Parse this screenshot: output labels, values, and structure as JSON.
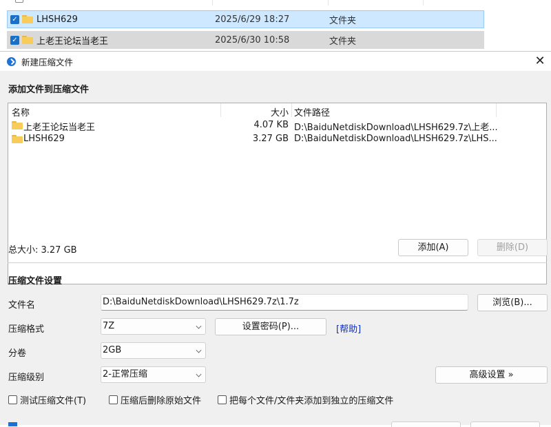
{
  "explorer": {
    "rows": [
      {
        "name": "LHSH629",
        "date": "2025/6/29 18:27",
        "type": "文件夹",
        "checked": true,
        "state": "selected"
      },
      {
        "name": "上老王论坛当老王",
        "date": "2025/6/30 10:58",
        "type": "文件夹",
        "checked": true,
        "state": "selected-inactive"
      }
    ]
  },
  "dialog": {
    "title": "新建压缩文件",
    "add_section_title": "添加文件到压缩文件",
    "list": {
      "col_name": "名称",
      "col_size": "大小",
      "col_path": "文件路径",
      "items": [
        {
          "name": "上老王论坛当老王",
          "size": "4.07 KB",
          "path": "D:\\BaiduNetdiskDownload\\LHSH629.7z\\上老..."
        },
        {
          "name": "LHSH629",
          "size": "3.27 GB",
          "path": "D:\\BaiduNetdiskDownload\\LHSH629.7z\\LHS..."
        }
      ]
    },
    "total_size": "总大小: 3.27 GB",
    "add_button": "添加(A)",
    "delete_button": "删除(D)",
    "settings_title": "压缩文件设置",
    "filename_label": "文件名",
    "filename_value": "D:\\BaiduNetdiskDownload\\LHSH629.7z\\1.7z",
    "browse_button": "浏览(B)...",
    "format_label": "压缩格式",
    "format_value": "7Z",
    "set_password_button": "设置密码(P)...",
    "help_link": "[帮助]",
    "volume_label": "分卷",
    "volume_value": "2GB",
    "level_label": "压缩级别",
    "level_value": "2-正常压缩",
    "advanced_button": "高级设置 »",
    "checkboxes": [
      {
        "label": "测试压缩文件(T)",
        "checked": false
      },
      {
        "label": "压缩后删除原始文件",
        "checked": false
      },
      {
        "label": "把每个文件/文件夹添加到独立的压缩文件",
        "checked": false
      }
    ]
  },
  "colors": {
    "selection": "#cde8ff",
    "selection_border": "#99c9f5",
    "inactive_selection": "#d9d9d9",
    "checkbox_accent": "#1a6fc9",
    "link": "#0b2ec4",
    "dialog_bg": "#f0f0f0"
  },
  "icons": {
    "folder": "folder-icon",
    "app": "app-icon",
    "close": "close-icon",
    "dropdown": "chevron-down-icon"
  }
}
